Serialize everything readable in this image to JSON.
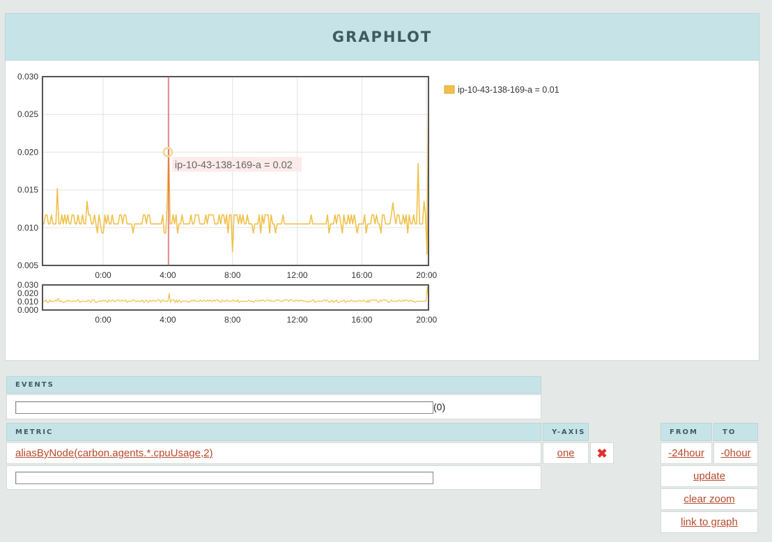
{
  "header": {
    "title": "GRAPHLOT"
  },
  "chart_data": [
    {
      "type": "line",
      "name": "main-graph",
      "series": [
        {
          "name": "ip-10-43-138-169-a",
          "color": "#f0c04a"
        }
      ],
      "legend": {
        "position": "top-right",
        "label": "ip-10-43-138-169-a = 0.01"
      },
      "tooltip": {
        "label": "ip-10-43-138-169-a = 0.02",
        "x": 4.0,
        "y": 0.02
      },
      "crosshair_x": 4.05,
      "xlim": [
        -3.75,
        20.12
      ],
      "ylim": [
        0.005,
        0.03
      ],
      "x_ticks": [
        "0:00",
        "4:00",
        "8:00",
        "12:00",
        "16:00",
        "20:00"
      ],
      "x_tick_values": [
        0,
        4,
        8,
        12,
        16,
        20
      ],
      "y_ticks": [
        "0.005",
        "0.010",
        "0.015",
        "0.020",
        "0.025",
        "0.030"
      ],
      "y_tick_values": [
        0.005,
        0.01,
        0.015,
        0.02,
        0.025,
        0.03
      ],
      "grid": true,
      "baseline": 0.0105,
      "peaks": [
        {
          "x": -2.8,
          "y": 0.0152
        },
        {
          "x": -1.0,
          "y": 0.0135
        },
        {
          "x": 3.95,
          "y": 0.0135
        },
        {
          "x": 4.05,
          "y": 0.0205
        },
        {
          "x": 17.95,
          "y": 0.0133
        },
        {
          "x": 19.5,
          "y": 0.0185
        },
        {
          "x": 19.8,
          "y": 0.0135
        },
        {
          "x": 20.08,
          "y": 0.0285
        }
      ],
      "dips": [
        {
          "x": 8.0,
          "y": 0.0068
        },
        {
          "x": 20.0,
          "y": 0.0065
        }
      ]
    },
    {
      "type": "line",
      "name": "overview-graph",
      "series": [
        {
          "name": "ip-10-43-138-169-a",
          "color": "#f0c04a"
        }
      ],
      "xlim": [
        -3.75,
        20.12
      ],
      "ylim": [
        0.0,
        0.03
      ],
      "x_ticks": [
        "0:00",
        "4:00",
        "8:00",
        "12:00",
        "16:00",
        "20:00"
      ],
      "x_tick_values": [
        0,
        4,
        8,
        12,
        16,
        20
      ],
      "y_ticks": [
        "0.030",
        "0.020",
        "0.010",
        "0.000"
      ],
      "y_tick_values": [
        0.03,
        0.02,
        0.01,
        0.0
      ]
    }
  ],
  "events": {
    "header": "EVENTS",
    "input_value": "",
    "count": "(0)"
  },
  "metrics": {
    "header_metric": "METRIC",
    "header_yaxis": "Y-AXIS",
    "rows": [
      {
        "target": "aliasByNode(carbon.agents.*.cpuUsage,2)",
        "yaxis": "one"
      }
    ],
    "new_input_value": ""
  },
  "time": {
    "header_from": "FROM",
    "header_to": "TO",
    "from": "-24hour",
    "to": "-0hour",
    "update": "update",
    "clear_zoom": "clear zoom",
    "link_to_graph": "link to graph"
  },
  "icons": {
    "remove": "close-icon"
  },
  "colors": {
    "accent": "#b64a2c",
    "header_bg": "#c6e4e7",
    "series": "#f0c04a",
    "crosshair": "#e05050"
  }
}
